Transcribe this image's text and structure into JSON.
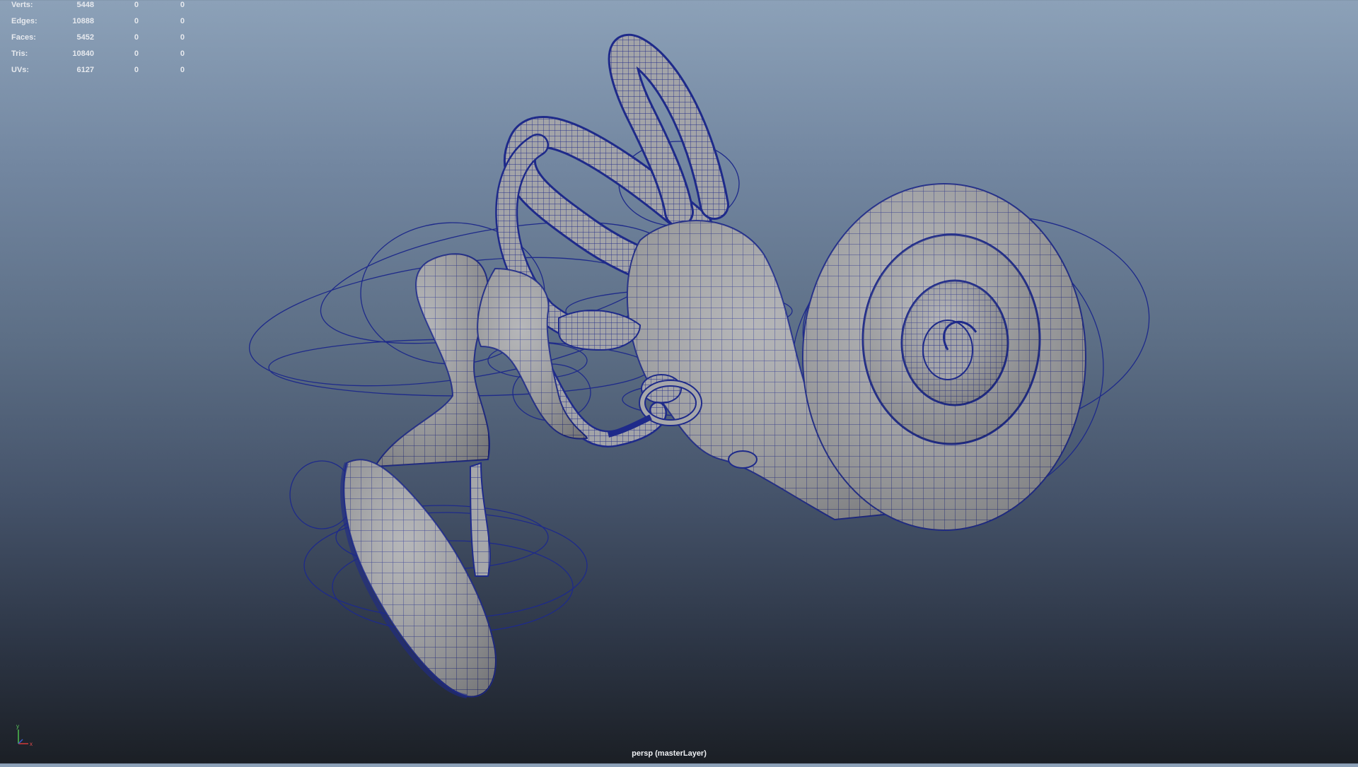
{
  "hud": {
    "rows": [
      {
        "label": "Verts:",
        "v1": "5448",
        "v2": "0",
        "v3": "0"
      },
      {
        "label": "Edges:",
        "v1": "10888",
        "v2": "0",
        "v3": "0"
      },
      {
        "label": "Faces:",
        "v1": "5452",
        "v2": "0",
        "v3": "0"
      },
      {
        "label": "Tris:",
        "v1": "10840",
        "v2": "0",
        "v3": "0"
      },
      {
        "label": "UVs:",
        "v1": "6127",
        "v2": "0",
        "v3": "0"
      }
    ]
  },
  "viewport": {
    "camera_label": "persp (masterLayer)",
    "wire_color": "#1e2a8a",
    "mesh_color": "#a9aaad"
  },
  "axis": {
    "y": "y",
    "x": "x"
  }
}
